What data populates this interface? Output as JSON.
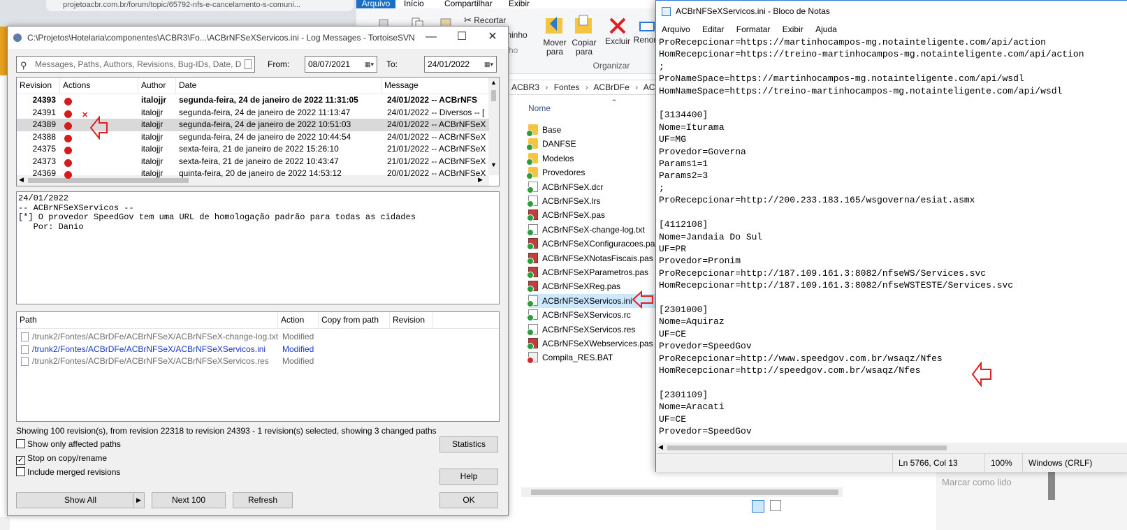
{
  "browser": {
    "url_fragment": "projetoacbr.com.br/forum/topic/65792-nfs-e-cancelamento-s-comuni..."
  },
  "explorer": {
    "ribbon_tabs": [
      "Arquivo",
      "Início",
      "Compartilhar",
      "Exibir"
    ],
    "ribbon_buttons": {
      "recortar": "Recortar",
      "caminho": "minho",
      "atalho": "ho",
      "mover_para": "Mover para",
      "copiar_para": "Copiar para",
      "excluir": "Excluir",
      "renomear": "Renom",
      "organizar": "Organizar"
    },
    "breadcrumb": [
      "ACBR3",
      "Fontes",
      "ACBrDFe",
      "ACBr"
    ],
    "column_header": "Nome",
    "files": [
      {
        "name": "Base",
        "type": "folder",
        "status": "ok"
      },
      {
        "name": "DANFSE",
        "type": "folder",
        "status": "ok"
      },
      {
        "name": "Modelos",
        "type": "folder",
        "status": "ok"
      },
      {
        "name": "Provedores",
        "type": "folder",
        "status": "ok"
      },
      {
        "name": "ACBrNFSeX.dcr",
        "type": "file",
        "status": "ok"
      },
      {
        "name": "ACBrNFSeX.lrs",
        "type": "file",
        "status": "ok"
      },
      {
        "name": "ACBrNFSeX.pas",
        "type": "pas",
        "status": "ok"
      },
      {
        "name": "ACBrNFSeX-change-log.txt",
        "type": "file",
        "status": "ok"
      },
      {
        "name": "ACBrNFSeXConfiguracoes.pas",
        "type": "pas",
        "status": "ok"
      },
      {
        "name": "ACBrNFSeXNotasFiscais.pas",
        "type": "pas",
        "status": "ok"
      },
      {
        "name": "ACBrNFSeXParametros.pas",
        "type": "pas",
        "status": "ok"
      },
      {
        "name": "ACBrNFSeXReg.pas",
        "type": "pas",
        "status": "ok"
      },
      {
        "name": "ACBrNFSeXServicos.ini",
        "type": "file",
        "status": "ok",
        "selected": true
      },
      {
        "name": "ACBrNFSeXServicos.rc",
        "type": "file",
        "status": "ok"
      },
      {
        "name": "ACBrNFSeXServicos.res",
        "type": "file",
        "status": "ok"
      },
      {
        "name": "ACBrNFSeXWebservices.pas",
        "type": "pas",
        "status": "ok"
      },
      {
        "name": "Compila_RES.BAT",
        "type": "bat",
        "status": "err"
      }
    ]
  },
  "svn": {
    "title": "C:\\Projetos\\Hotelaria\\componentes\\ACBR3\\Fo...\\ACBrNFSeXServicos.ini - Log Messages - TortoiseSVN",
    "search_placeholder": "Messages, Paths, Authors, Revisions, Bug-IDs, Date, D",
    "from_label": "From:",
    "from_value": "08/07/2021",
    "to_label": "To:",
    "to_value": "24/01/2022",
    "columns": [
      "Revision",
      "Actions",
      "Author",
      "Date",
      "Message"
    ],
    "rows": [
      {
        "revision": "24393",
        "author": "italojjr",
        "date": "segunda-feira, 24 de janeiro de 2022 11:31:05",
        "message": "24/01/2022 -- ACBrNFS",
        "bold": true
      },
      {
        "revision": "24391",
        "author": "italojjr",
        "date": "segunda-feira, 24 de janeiro de 2022 11:13:47",
        "message": "24/01/2022 -- Diversos -- [",
        "deleted": true
      },
      {
        "revision": "24389",
        "author": "italojjr",
        "date": "segunda-feira, 24 de janeiro de 2022 10:51:03",
        "message": "24/01/2022 -- ACBrNFSeX",
        "selected": true
      },
      {
        "revision": "24388",
        "author": "italojjr",
        "date": "segunda-feira, 24 de janeiro de 2022 10:44:54",
        "message": "24/01/2022 -- ACBrNFSeX"
      },
      {
        "revision": "24375",
        "author": "italojjr",
        "date": "sexta-feira, 21 de janeiro de 2022 15:26:10",
        "message": "21/01/2022 -- ACBrNFSeX"
      },
      {
        "revision": "24373",
        "author": "italojjr",
        "date": "sexta-feira, 21 de janeiro de 2022 10:43:47",
        "message": "21/01/2022 -- ACBrNFSeX"
      },
      {
        "revision": "24369",
        "author": "italojjr",
        "date": "quinta-feira, 20 de janeiro de 2022 14:53:12",
        "message": "20/01/2022 -- ACBrNFSeX"
      }
    ],
    "message": "24/01/2022\n-- ACBrNFSeXServicos --\n[*] O provedor SpeedGov tem uma URL de homologação padrão para todas as cidades\n   Por: Danio",
    "path_columns": [
      "Path",
      "Action",
      "Copy from path",
      "Revision"
    ],
    "paths": [
      {
        "path": "/trunk2/Fontes/ACBrDFe/ACBrNFSeX/ACBrNFSeX-change-log.txt",
        "action": "Modified"
      },
      {
        "path": "/trunk2/Fontes/ACBrDFe/ACBrNFSeX/ACBrNFSeXServicos.ini",
        "action": "Modified",
        "highlight": true
      },
      {
        "path": "/trunk2/Fontes/ACBrDFe/ACBrNFSeX/ACBrNFSeXServicos.res",
        "action": "Modified"
      }
    ],
    "status_text": "Showing 100 revision(s), from revision 22318 to revision 24393 - 1 revision(s) selected, showing 3 changed paths",
    "checkboxes": [
      {
        "label": "Show only affected paths",
        "checked": false
      },
      {
        "label": "Stop on copy/rename",
        "checked": true
      },
      {
        "label": "Include merged revisions",
        "checked": false
      }
    ],
    "buttons": {
      "statistics": "Statistics",
      "help": "Help",
      "ok": "OK",
      "show_all": "Show All",
      "next_100": "Next 100",
      "refresh": "Refresh"
    }
  },
  "notepad": {
    "title": "ACBrNFSeXServicos.ini - Bloco de Notas",
    "menu": [
      "Arquivo",
      "Editar",
      "Formatar",
      "Exibir",
      "Ajuda"
    ],
    "text": "ProRecepcionar=https://martinhocampos-mg.notainteligente.com/api/action\nHomRecepcionar=https://treino-martinhocampos-mg.notainteligente.com/api/action\n;\nProNameSpace=https://martinhocampos-mg.notainteligente.com/api/wsdl\nHomNameSpace=https://treino-martinhocampos-mg.notainteligente.com/api/wsdl\n\n[3134400]\nNome=Iturama\nUF=MG\nProvedor=Governa\nParams1=1\nParams2=3\n;\nProRecepcionar=http://200.233.183.165/wsgoverna/esiat.asmx\n\n[4112108]\nNome=Jandaia Do Sul\nUF=PR\nProvedor=Pronim\nProRecepcionar=http://187.109.161.3:8082/nfseWS/Services.svc\nHomRecepcionar=http://187.109.161.3:8082/nfseWSTESTE/Services.svc\n\n[2301000]\nNome=Aquiraz\nUF=CE\nProvedor=SpeedGov\nProRecepcionar=http://www.speedgov.com.br/wsaqz/Nfes\nHomRecepcionar=http://speedgov.com.br/wsaqz/Nfes\n\n[2301109]\nNome=Aracati\nUF=CE\nProvedor=SpeedGov",
    "status": {
      "position": "Ln 5766, Col 13",
      "zoom": "100%",
      "encoding": "Windows (CRLF)"
    }
  },
  "background": {
    "marcar_lido": "Marcar como lido"
  },
  "colors": {
    "accent": "#1a6fc4",
    "annotation_red": "#e02020",
    "error_red": "#d41c1c",
    "ok_green": "#2b9e3a"
  }
}
